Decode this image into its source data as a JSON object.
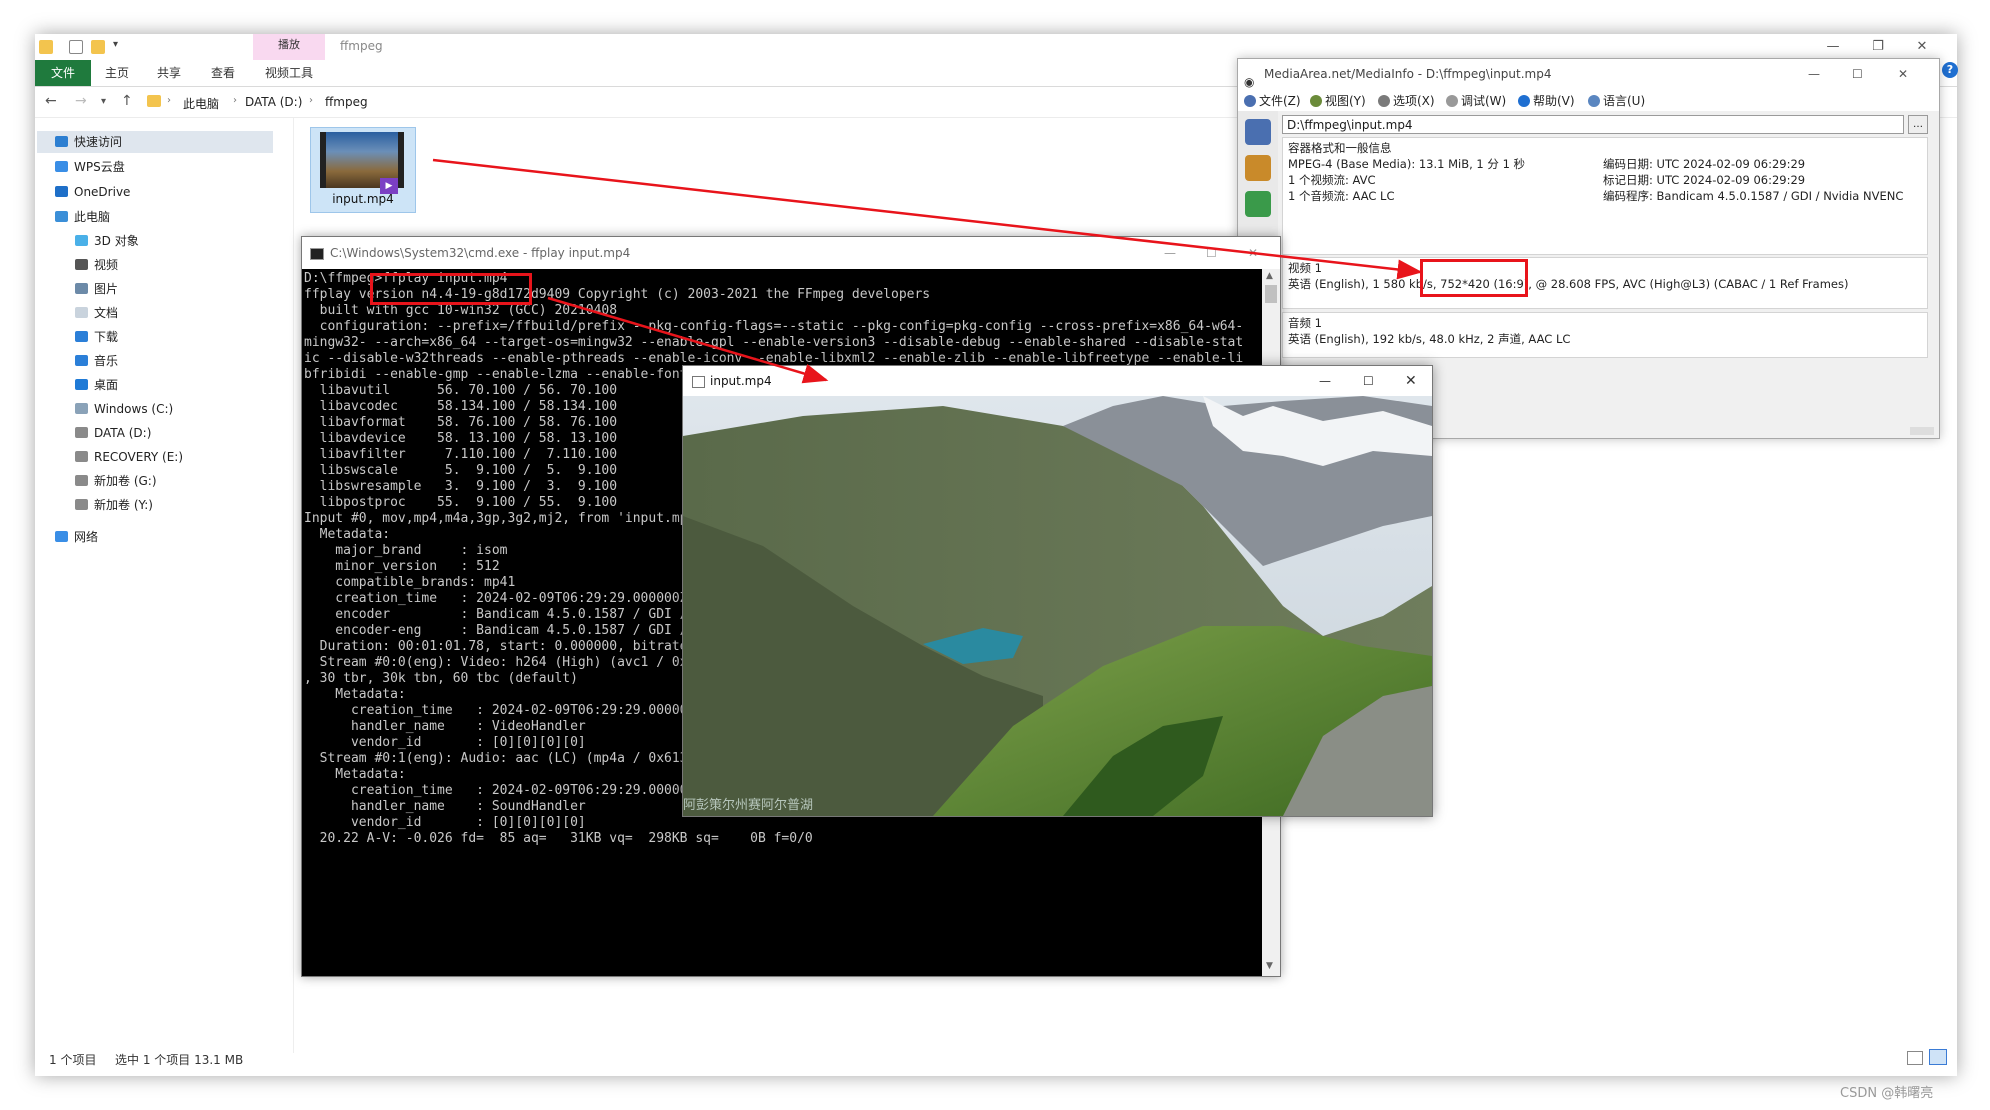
{
  "explorer": {
    "context_tab": "播放",
    "title": "ffmpeg",
    "ribbon": {
      "file": "文件",
      "home": "主页",
      "share": "共享",
      "view": "查看",
      "video_tools": "视频工具"
    },
    "breadcrumb": [
      "此电脑",
      "DATA (D:)",
      "ffmpeg"
    ],
    "nav": {
      "quick_access": "快速访问",
      "wps": "WPS云盘",
      "onedrive": "OneDrive",
      "this_pc": "此电脑",
      "objects3d": "3D 对象",
      "videos": "视频",
      "pictures": "图片",
      "documents": "文档",
      "downloads": "下载",
      "music": "音乐",
      "desktop": "桌面",
      "drive_c": "Windows (C:)",
      "drive_d": "DATA (D:)",
      "drive_e": "RECOVERY (E:)",
      "drive_g": "新加卷 (G:)",
      "drive_y": "新加卷 (Y:)",
      "network": "网络"
    },
    "file": {
      "name": "input.mp4"
    },
    "status": {
      "count": "1 个项目",
      "selected": "选中 1 个项目  13.1 MB"
    }
  },
  "mediainfo": {
    "title": "MediaArea.net/MediaInfo - D:\\ffmpeg\\input.mp4",
    "menu": [
      "文件(Z)",
      "视图(Y)",
      "选项(X)",
      "调试(W)",
      "帮助(V)",
      "语言(U)"
    ],
    "path": "D:\\ffmpeg\\input.mp4",
    "general_header": "容器格式和一般信息",
    "general_left": [
      "MPEG-4 (Base Media): 13.1 MiB, 1 分 1 秒",
      "1 个视频流: AVC",
      "1 个音频流: AAC LC"
    ],
    "general_right": [
      "编码日期: UTC 2024-02-09 06:29:29",
      "标记日期: UTC 2024-02-09 06:29:29",
      "编码程序: Bandicam 4.5.0.1587 / GDI / Nvidia NVENC"
    ],
    "video_header": "视频 1",
    "video_line": "英语 (English), 1 580 kb/s, 752*420 (16:9), @ 28.608 FPS, AVC (High@L3) (CABAC / 1 Ref Frames)",
    "audio_header": "音频 1",
    "audio_line": "英语 (English), 192 kb/s, 48.0 kHz, 2 声道, AAC LC"
  },
  "cmd": {
    "title": "C:\\Windows\\System32\\cmd.exe - ffplay  input.mp4",
    "output": "D:\\ffmpeg>ffplay input.mp4\nffplay version n4.4-19-g8d172d9409 Copyright (c) 2003-2021 the FFmpeg developers\n  built with gcc 10-win32 (GCC) 20210408\n  configuration: --prefix=/ffbuild/prefix --pkg-config-flags=--static --pkg-config=pkg-config --cross-prefix=x86_64-w64-\nmingw32- --arch=x86_64 --target-os=mingw32 --enable-gpl --enable-version3 --disable-debug --enable-shared --disable-stat\nic --disable-w32threads --enable-pthreads --enable-iconv --enable-libxml2 --enable-zlib --enable-libfreetype --enable-li\nbfribidi --enable-gmp --enable-lzma --enable-fontconfig --enable-libvorbis --enable-opencl --disable-libpulse --enable-libvmaf --disable-libxcb --disable-xlib --enable-amf --enable-libaom --enable-avisynth --enable-libdav1d --enable-libdavs2 --disable-libfdk-aac --enable-ffnvcodec --enable-cuda-llvm --enable-frei0r --enable-libgme --enable-libass --enable-libbluray --enable-libmp3lame --enable-libopus --enable-librist --enable-libtheora --enable-libvpx --enable-libwebp --enable-lv2 --enable-libmfx --enable-libopencore-amrnb --enable-libopencore-amrwb --enable-libopenjpeg --enable-librav1e --enable-librubberband --enable-schannel --enable-sdl2 --enable-libsoxr --enable-libsrt --enable-libsvtav1 --enable-libtwolame --enable-libuavs3d --disable-libdrm --disable-vaapi --enable-libvidstab --enable-vulkan --enable-libx264 --enable-libx265 --enable-libxavs2 --enable-libxvid --enable-libzimg --extra-cflags=-DLIBTWOLAME_STATIC --extra-cxxflags= --extra-ldflags=-pthread --extra-ldexeflags= --extra-libs=-lgomp --extra-version=20210907\n  libavutil      56. 70.100 / 56. 70.100\n  libavcodec     58.134.100 / 58.134.100\n  libavformat    58. 76.100 / 58. 76.100\n  libavdevice    58. 13.100 / 58. 13.100\n  libavfilter     7.110.100 /  7.110.100\n  libswscale      5.  9.100 /  5.  9.100\n  libswresample   3.  9.100 /  3.  9.100\n  libpostproc    55.  9.100 / 55.  9.100\nInput #0, mov,mp4,m4a,3gp,3g2,mj2, from 'input.mp4':\n  Metadata:\n    major_brand     : isom\n    minor_version   : 512\n    compatible_brands: mp41\n    creation_time   : 2024-02-09T06:29:29.000000Z\n    encoder         : Bandicam 4.5.0.1587 / GDI / Nvidia NVENC\n    encoder-eng     : Bandicam 4.5.0.1587 / GDI / Nvidia NVENC\n  Duration: 00:01:01.78, start: 0.000000, bitrate: 1781 kb/s\n  Stream #0:0(eng): Video: h264 (High) (avc1 / 0x31637661), yuv420p, 752x420 [SAR 1:1 DAR 188:105], 1580 kb/s, 28.61 fps\n, 30 tbr, 30k tbn, 60 tbc (default)\n    Metadata:\n      creation_time   : 2024-02-09T06:29:29.000000Z\n      handler_name    : VideoHandler\n      vendor_id       : [0][0][0][0]\n  Stream #0:1(eng): Audio: aac (LC) (mp4a / 0x6134706D), 48000 Hz, stereo, fltp, 195 kb/s (default)\n    Metadata:\n      creation_time   : 2024-02-09T06:29:29.000000Z\n      handler_name    : SoundHandler\n      vendor_id       : [0][0][0][0]\n  20.22 A-V: -0.026 fd=  85 aq=   31KB vq=  298KB sq=    0B f=0/0"
  },
  "ffplay": {
    "title": "input.mp4",
    "subtitle": "阿彭策尔州赛阿尔普湖"
  },
  "watermark": "CSDN @韩曙亮",
  "colors": {
    "annotation": "#e8141b",
    "ribbon_file": "#1f7a3d",
    "context_tab": "#f9d9f0",
    "selection": "#cde4f7"
  }
}
